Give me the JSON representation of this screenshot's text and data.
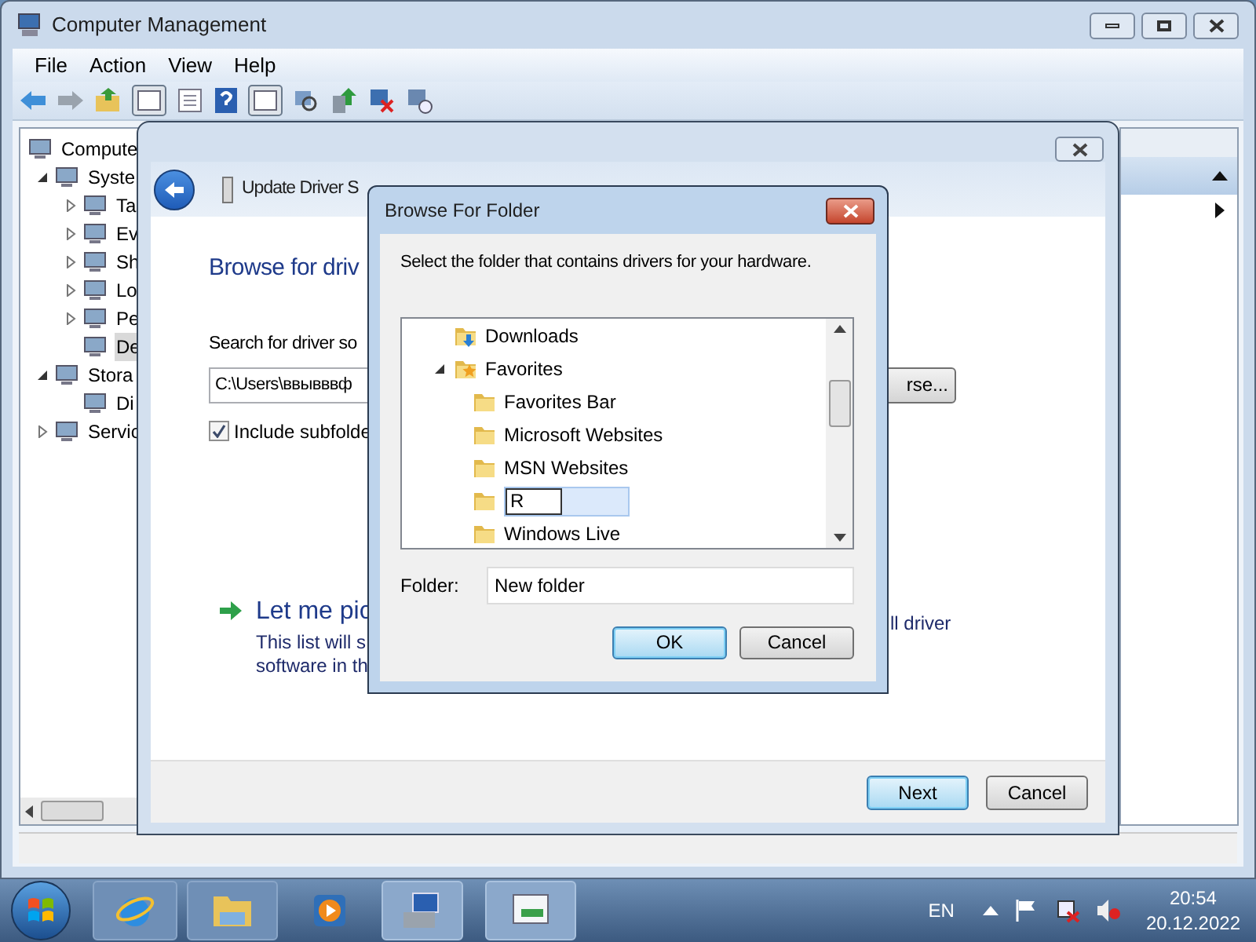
{
  "main_window": {
    "title": "Computer Management",
    "menu": [
      "File",
      "Action",
      "View",
      "Help"
    ],
    "tree": [
      {
        "label": "Compute",
        "selected": false,
        "children": [
          {
            "label": "Syste",
            "expanded": true,
            "selected": false,
            "children": [
              {
                "label": "Ta",
                "expanded": false,
                "selected": false
              },
              {
                "label": "Ev",
                "expanded": false,
                "selected": false
              },
              {
                "label": "Sh",
                "expanded": false,
                "selected": false
              },
              {
                "label": "Lo",
                "expanded": false,
                "selected": false
              },
              {
                "label": "Pe",
                "expanded": false,
                "selected": false
              },
              {
                "label": "De",
                "selected": true
              }
            ]
          },
          {
            "label": "Stora",
            "expanded": true,
            "selected": false,
            "children": [
              {
                "label": "Di",
                "selected": false
              }
            ]
          },
          {
            "label": "Servic",
            "expanded": false,
            "selected": false
          }
        ]
      }
    ]
  },
  "update_dialog": {
    "title": "Update Driver S",
    "heading": "Browse for driv",
    "search_label": "Search for driver so",
    "path_value": "C:\\Users\\ввывввф",
    "include_subfolders": {
      "label": "Include subfolde",
      "checked": true
    },
    "browse_button": "rse...",
    "pick_option": {
      "title": "Let me pic",
      "lines": [
        "This list will s",
        "software in th"
      ],
      "tail": "ll driver"
    },
    "buttons": [
      {
        "label": "Next",
        "default": true
      },
      {
        "label": "Cancel",
        "default": false
      }
    ]
  },
  "browse_dialog": {
    "title": "Browse For Folder",
    "instruction": "Select the folder that contains drivers for your hardware.",
    "tree": [
      {
        "kind": "downloads",
        "label": "Downloads"
      },
      {
        "kind": "favorites",
        "label": "Favorites",
        "expanded": true,
        "children": [
          {
            "kind": "folder",
            "label": "Favorites Bar"
          },
          {
            "kind": "folder",
            "label": "Microsoft Websites"
          },
          {
            "kind": "folder",
            "label": "MSN Websites"
          },
          {
            "kind": "editing",
            "label": "R"
          },
          {
            "kind": "folder",
            "label": "Windows Live"
          }
        ]
      }
    ],
    "folder_label": "Folder:",
    "folder_value": "New folder",
    "buttons": [
      {
        "label": "OK",
        "default": true
      },
      {
        "label": "Cancel",
        "default": false
      }
    ]
  },
  "taskbar": {
    "language": "EN",
    "time": "20:54",
    "date": "20.12.2022"
  }
}
